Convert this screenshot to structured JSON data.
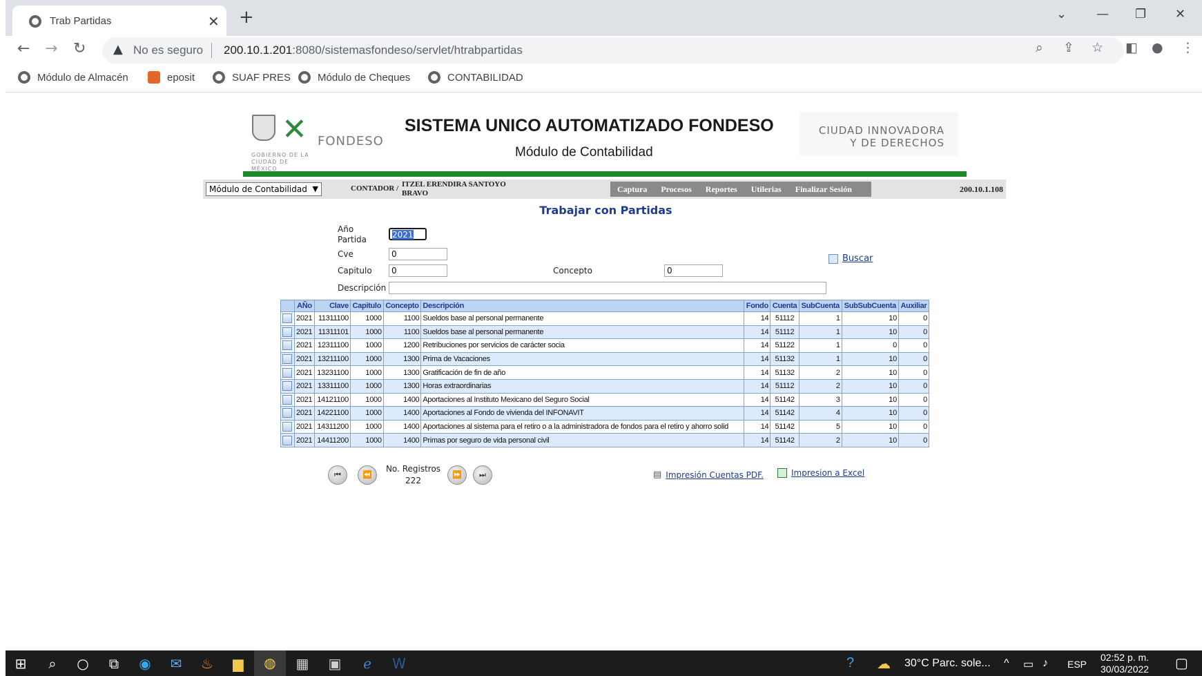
{
  "browser": {
    "tab_title": "Trab Partidas",
    "security_text": "No es seguro",
    "url_host": "200.10.1.201",
    "url_rest": ":8080/sistemasfondeso/servlet/htrabpartidas",
    "bookmarks": [
      {
        "label": "Módulo de Almacén",
        "icon": "globe-icon"
      },
      {
        "label": "eposit",
        "icon": "app-icon"
      },
      {
        "label": "SUAF PRES",
        "icon": "globe-icon"
      },
      {
        "label": "Módulo de Cheques",
        "icon": "globe-icon"
      },
      {
        "label": "CONTABILIDAD",
        "icon": "globe-icon"
      }
    ]
  },
  "header": {
    "gobierno_text": "GOBIERNO DE LA CIUDAD DE MÉXICO",
    "fondeso_logo": "FONDESO",
    "system_title": "SISTEMA UNICO AUTOMATIZADO FONDESO",
    "module_title": "Módulo de Contabilidad",
    "ciudad_line1": "CIUDAD INNOVADORA",
    "ciudad_line2": "Y DE DERECHOS",
    "brand_green": "#1f8a2c"
  },
  "navbar": {
    "module_select": "Módulo de Contabilidad",
    "role": "CONTADOR /",
    "user": "ITZEL ERENDIRA SANTOYO BRAVO",
    "menu": [
      "Captura",
      "Procesos",
      "Reportes",
      "Utilerias",
      "Finalizar Sesión"
    ],
    "ip": "200.10.1.108"
  },
  "page": {
    "title": "Trabajar con Partidas",
    "form": {
      "anio_label_1": "Año",
      "anio_label_2": "Partida",
      "anio_value": "2021",
      "cve_label": "Cve",
      "cve_value": "0",
      "capitulo_label": "Capitulo",
      "capitulo_value": "0",
      "concepto_label": "Concepto",
      "concepto_value": "0",
      "descripcion_label": "Descripción",
      "descripcion_value": "",
      "buscar": "Buscar"
    },
    "table": {
      "headers": [
        "AÑo",
        "Clave",
        "Capitulo",
        "Concepto",
        "Descripción",
        "Fondo",
        "Cuenta",
        "SubCuenta",
        "SubSubCuenta",
        "Auxiliar"
      ],
      "rows": [
        [
          "2021",
          "11311100",
          "1000",
          "1100",
          "Sueldos base al personal permanente",
          "14",
          "51112",
          "1",
          "10",
          "0"
        ],
        [
          "2021",
          "11311101",
          "1000",
          "1100",
          "Sueldos base al personal permanente",
          "14",
          "51112",
          "1",
          "10",
          "0"
        ],
        [
          "2021",
          "12311100",
          "1000",
          "1200",
          "Retribuciones por servicios de carácter socia",
          "14",
          "51122",
          "1",
          "0",
          "0"
        ],
        [
          "2021",
          "13211100",
          "1000",
          "1300",
          "Prima de Vacaciones",
          "14",
          "51132",
          "1",
          "10",
          "0"
        ],
        [
          "2021",
          "13231100",
          "1000",
          "1300",
          "Gratificación de fin de año",
          "14",
          "51132",
          "2",
          "10",
          "0"
        ],
        [
          "2021",
          "13311100",
          "1000",
          "1300",
          "Horas extraordinarias",
          "14",
          "51112",
          "2",
          "10",
          "0"
        ],
        [
          "2021",
          "14121100",
          "1000",
          "1400",
          "Aportaciones al Instituto Mexicano del Seguro Social",
          "14",
          "51142",
          "3",
          "10",
          "0"
        ],
        [
          "2021",
          "14221100",
          "1000",
          "1400",
          "Aportaciones al Fondo de vivienda del INFONAVIT",
          "14",
          "51142",
          "4",
          "10",
          "0"
        ],
        [
          "2021",
          "14311200",
          "1000",
          "1400",
          "Aportaciones al sistema para el retiro o a la administradora de fondos para el retiro y ahorro solid",
          "14",
          "51142",
          "5",
          "10",
          "0"
        ],
        [
          "2021",
          "14411200",
          "1000",
          "1400",
          "Primas por seguro de vida personal civil",
          "14",
          "51142",
          "2",
          "10",
          "0"
        ]
      ]
    },
    "pager": {
      "registros_label": "No. Registros",
      "registros_value": "222"
    },
    "export_pdf": "Impresión Cuentas PDF.",
    "export_excel": "Impresion a Excel"
  },
  "taskbar": {
    "weather": "30°C  Parc. sole...",
    "lang": "ESP",
    "time": "02:52 p. m.",
    "date": "30/03/2022"
  }
}
